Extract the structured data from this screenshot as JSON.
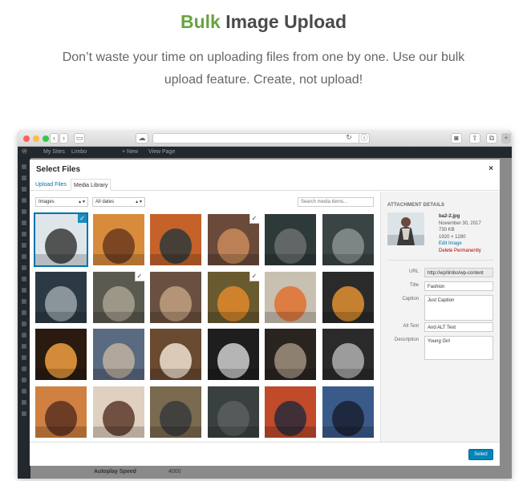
{
  "hero": {
    "title_accent": "Bulk",
    "title_rest": " Image Upload",
    "subtitle": "Don’t waste your time on uploading files from one by one. Use our bulk upload feature. Create, not upload!"
  },
  "adminbar": {
    "my_sites": "My Sites",
    "site_name": "Limbo",
    "new": "+ New",
    "view_page": "View Page"
  },
  "modal": {
    "title": "Select Files",
    "close": "×",
    "tabs": [
      {
        "label": "Upload Files",
        "active": false
      },
      {
        "label": "Media Library",
        "active": true
      }
    ],
    "filter_type": "Images",
    "filter_date": "All dates",
    "search_placeholder": "Search media items...",
    "select_label": "Select"
  },
  "details": {
    "heading": "ATTACHMENT DETAILS",
    "filename": "ba2-2.jpg",
    "date": "November 30, 2017",
    "size": "730 KB",
    "dimensions": "1920 × 1280",
    "edit_link": "Edit Image",
    "delete_link": "Delete Permanently",
    "url_label": "URL",
    "url_value": "http://wp/limbo/wp-content",
    "title_label": "Title",
    "title_value": "Fashion",
    "caption_label": "Caption",
    "caption_value": "Just Caption",
    "alt_label": "Alt Text",
    "alt_value": "And ALT Text",
    "desc_label": "Description",
    "desc_value": "Young Girl"
  },
  "background": {
    "setting_label": "Autoplay Speed",
    "setting_value": "4000"
  },
  "thumbnails": [
    {
      "name": "photo-girl-scarf",
      "selected": true,
      "checked": true,
      "c1": "#dfe6ea",
      "c2": "#3a3a3a"
    },
    {
      "name": "photo-camera-girl",
      "selected": false,
      "checked": false,
      "c1": "#d98b3c",
      "c2": "#6b3a1e"
    },
    {
      "name": "photo-waterfall-autumn",
      "selected": false,
      "checked": false,
      "c1": "#c4622a",
      "c2": "#2f3a3a"
    },
    {
      "name": "photo-waterfall-cliff",
      "selected": false,
      "checked": true,
      "c1": "#6a4a3a",
      "c2": "#c98a5a"
    },
    {
      "name": "photo-dark-waterfall",
      "selected": false,
      "checked": false,
      "c1": "#2e3a3a",
      "c2": "#6a7070"
    },
    {
      "name": "photo-forest-falls",
      "selected": false,
      "checked": false,
      "c1": "#3a4444",
      "c2": "#8a9090"
    },
    {
      "name": "photo-woman-stairs",
      "selected": false,
      "checked": false,
      "c1": "#2c3a45",
      "c2": "#9aa5aa"
    },
    {
      "name": "photo-rope-close",
      "selected": false,
      "checked": true,
      "c1": "#5a5a50",
      "c2": "#a8a290"
    },
    {
      "name": "photo-rope-coil",
      "selected": false,
      "checked": false,
      "c1": "#6a5040",
      "c2": "#c0a080"
    },
    {
      "name": "photo-pumpkin-leaves",
      "selected": false,
      "checked": true,
      "c1": "#6a5a30",
      "c2": "#e08a2a"
    },
    {
      "name": "photo-pumpkin-knit",
      "selected": false,
      "checked": false,
      "c1": "#c8c0b0",
      "c2": "#e07030"
    },
    {
      "name": "photo-pumpkin-dark",
      "selected": false,
      "checked": false,
      "c1": "#2a2a2a",
      "c2": "#e09030"
    },
    {
      "name": "photo-lantern",
      "selected": false,
      "checked": false,
      "c1": "#2a1a10",
      "c2": "#f0a040"
    },
    {
      "name": "photo-jeans-shoes",
      "selected": false,
      "checked": false,
      "c1": "#5a6a80",
      "c2": "#c0b0a0"
    },
    {
      "name": "photo-latte-art",
      "selected": false,
      "checked": false,
      "c1": "#6a4a30",
      "c2": "#f0e0d0"
    },
    {
      "name": "photo-desk-chair",
      "selected": false,
      "checked": false,
      "c1": "#1e1e1e",
      "c2": "#d0d0d0"
    },
    {
      "name": "photo-cabin-window",
      "selected": false,
      "checked": false,
      "c1": "#2a2420",
      "c2": "#a09080"
    },
    {
      "name": "photo-laptop-desk",
      "selected": false,
      "checked": false,
      "c1": "#2a2a2a",
      "c2": "#b0b0b0"
    },
    {
      "name": "photo-girl-sunset",
      "selected": false,
      "checked": false,
      "c1": "#d08040",
      "c2": "#5a3020"
    },
    {
      "name": "photo-girl-portrait",
      "selected": false,
      "checked": false,
      "c1": "#e0d0c0",
      "c2": "#5a3a2a"
    },
    {
      "name": "photo-man-smiling",
      "selected": false,
      "checked": false,
      "c1": "#7a6a50",
      "c2": "#3a3a3a"
    },
    {
      "name": "photo-foggy-forest",
      "selected": false,
      "checked": false,
      "c1": "#3a4040",
      "c2": "#5a6060"
    },
    {
      "name": "photo-red-mountain",
      "selected": false,
      "checked": false,
      "c1": "#c04a2a",
      "c2": "#2a2a3a"
    },
    {
      "name": "photo-coast-night",
      "selected": false,
      "checked": false,
      "c1": "#3a5a8a",
      "c2": "#1a2030"
    }
  ]
}
